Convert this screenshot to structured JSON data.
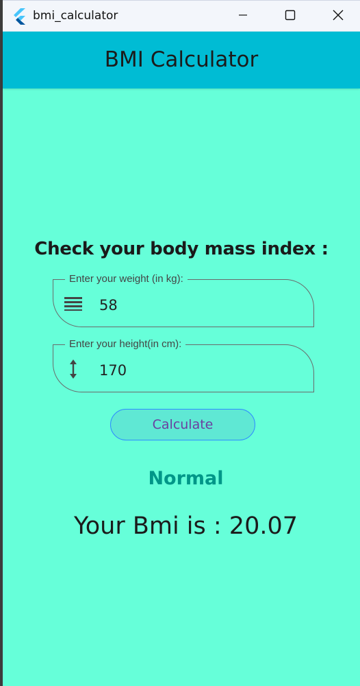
{
  "window": {
    "title": "bmi_calculator",
    "controls": [
      "minimize-icon",
      "maximize-icon",
      "close-icon"
    ]
  },
  "appbar": {
    "title": "BMI Calculator",
    "color": "#00bcd4"
  },
  "main": {
    "background": "#66ffd9",
    "heading": "Check your body mass index :",
    "weight_field": {
      "label": "Enter your weight (in kg):",
      "value": "58",
      "icon": "weight-lines-icon"
    },
    "height_field": {
      "label": "Enter your height(in cm):",
      "value": "170",
      "icon": "height-arrows-icon"
    },
    "calculate_label": "Calculate",
    "status": "Normal",
    "status_color": "#009688",
    "result": "Your Bmi is : 20.07"
  }
}
